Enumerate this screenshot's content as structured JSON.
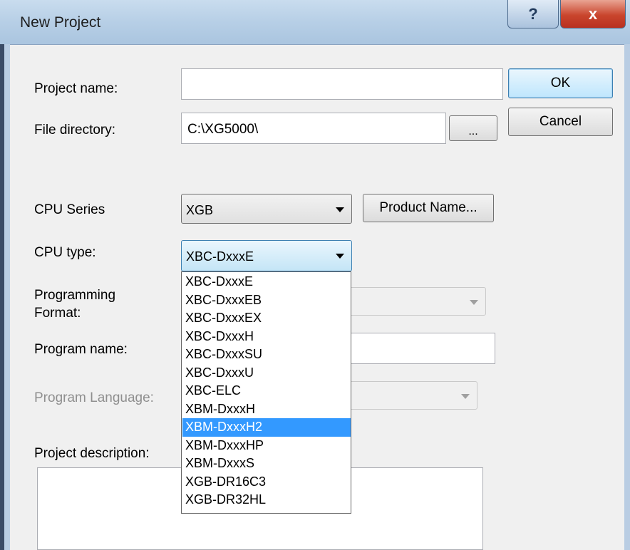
{
  "window": {
    "title": "New Project",
    "help_glyph": "?",
    "close_glyph": "x"
  },
  "form": {
    "project_name_label": "Project name:",
    "project_name_value": "",
    "file_directory_label": "File directory:",
    "file_directory_value": "C:\\XG5000\\",
    "browse_label": "...",
    "cpu_series_label": "CPU Series",
    "cpu_series_value": "XGB",
    "product_name_label": "Product Name...",
    "cpu_type_label": "CPU type:",
    "cpu_type_value": "XBC-DxxxE",
    "programming_format_label_line1": "Programming",
    "programming_format_label_line2": "Format:",
    "program_name_label": "Program name:",
    "program_language_label": "Program Language:",
    "project_description_label": "Project description:"
  },
  "buttons": {
    "ok": "OK",
    "cancel": "Cancel"
  },
  "cpu_type_options": [
    "XBC-DxxxE",
    "XBC-DxxxEB",
    "XBC-DxxxEX",
    "XBC-DxxxH",
    "XBC-DxxxSU",
    "XBC-DxxxU",
    "XBC-ELC",
    "XBM-DxxxH",
    "XBM-DxxxH2",
    "XBM-DxxxHP",
    "XBM-DxxxS",
    "XGB-DR16C3",
    "XGB-DR32HL"
  ],
  "cpu_type_highlighted": "XBM-DxxxH2",
  "icons": {
    "dropdown": "chevron-down-icon",
    "help": "help-icon",
    "close": "close-icon"
  }
}
